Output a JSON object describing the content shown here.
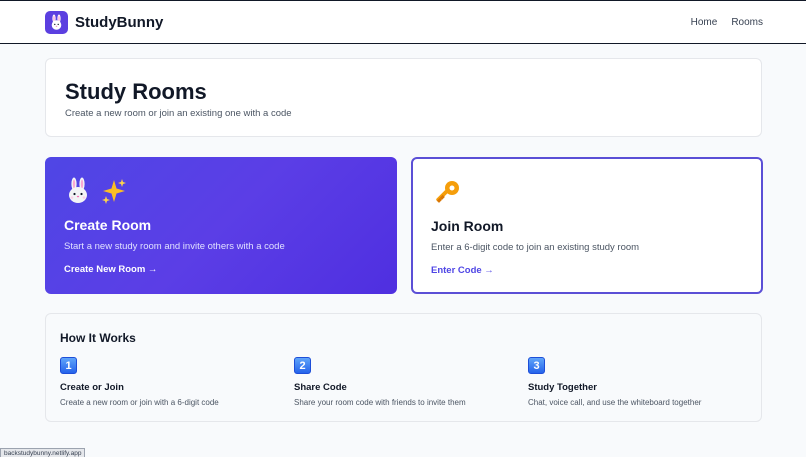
{
  "brand": {
    "name": "StudyBunny",
    "logo_icon": "bunny-icon"
  },
  "nav": {
    "items": [
      {
        "label": "Home"
      },
      {
        "label": "Rooms"
      }
    ]
  },
  "header": {
    "title": "Study Rooms",
    "subtitle": "Create a new room or join an existing one with a code"
  },
  "create_room": {
    "icons": [
      "rabbit-icon",
      "sparkles-icon"
    ],
    "title": "Create Room",
    "description": "Start a new study room and invite others with a code",
    "link": "Create New Room →"
  },
  "join_room": {
    "icon": "key-icon",
    "title": "Join Room",
    "description": "Enter a 6-digit code to join an existing study room",
    "link": "Enter Code →"
  },
  "how_it_works": {
    "title": "How It Works",
    "steps": [
      {
        "number": "1",
        "title": "Create or Join",
        "description": "Create a new room or join with a 6-digit code"
      },
      {
        "number": "2",
        "title": "Share Code",
        "description": "Share your room code with friends to invite them"
      },
      {
        "number": "3",
        "title": "Study Together",
        "description": "Chat, voice call, and use the whiteboard together"
      }
    ]
  },
  "status_bar": {
    "url": "backstudybunny.netlify.app"
  },
  "colors": {
    "accent": "#4f46e5",
    "background": "#f8fafc",
    "badge": "#3b82f6"
  }
}
